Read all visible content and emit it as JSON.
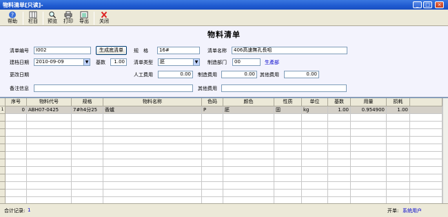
{
  "window": {
    "title": "物料清单[只读]-"
  },
  "toolbar": {
    "help": "帮助",
    "columns": "栏目",
    "preview": "预览",
    "print": "打印",
    "export": "导出",
    "close": "关闭"
  },
  "form": {
    "title": "物料清单",
    "bom_no_label": "清单编号",
    "bom_no_value": "I002",
    "generate_button": "生成底清单",
    "spec_label": "规　格",
    "spec_value": "16#",
    "bom_name_label": "清单名称",
    "bom_name_value": "406高速無孔長咀",
    "date_label": "建档日期",
    "date_value": "2010-09-09",
    "base_qty_label": "基数",
    "base_qty_value": "1.00",
    "bom_type_label": "清单类型",
    "bom_type_value": "胚",
    "mfg_dept_label": "制造部门",
    "mfg_dept_value": "00",
    "mfg_dept_link": "生產部",
    "modified_date_label": "更改日期",
    "labor_cost_label": "人工费用",
    "labor_cost_value": "0.00",
    "mfg_cost_label": "制造费用",
    "mfg_cost_value": "0.00",
    "other_cost_label": "其他费用",
    "other_cost_value": "0.00",
    "remark_label": "备注信息",
    "remark_value": "",
    "other_fee_label": "其他费用",
    "other_fee_value": ""
  },
  "grid": {
    "headers": [
      "序号",
      "物料代号",
      "规格",
      "物料名称",
      "色码",
      "颜色",
      "性质",
      "单位",
      "基数",
      "用量",
      "损耗"
    ],
    "rows": [
      {
        "marker": "1 ▶",
        "cells": [
          "0",
          "ABH07-0425",
          "7#h4分25",
          "香爐",
          "P",
          "胚",
          "固",
          "kg",
          "1.00",
          "0.954900",
          "1.00"
        ]
      }
    ]
  },
  "status": {
    "count_label": "合计记录:",
    "count_value": "1",
    "creator_label": "开单:",
    "creator_value": "系统用户"
  },
  "colors": {
    "title_bar": "#1f5bd0",
    "form_bg": "#f3f3fd",
    "link": "#0000cc",
    "selected_row": "#d4d0c8"
  }
}
